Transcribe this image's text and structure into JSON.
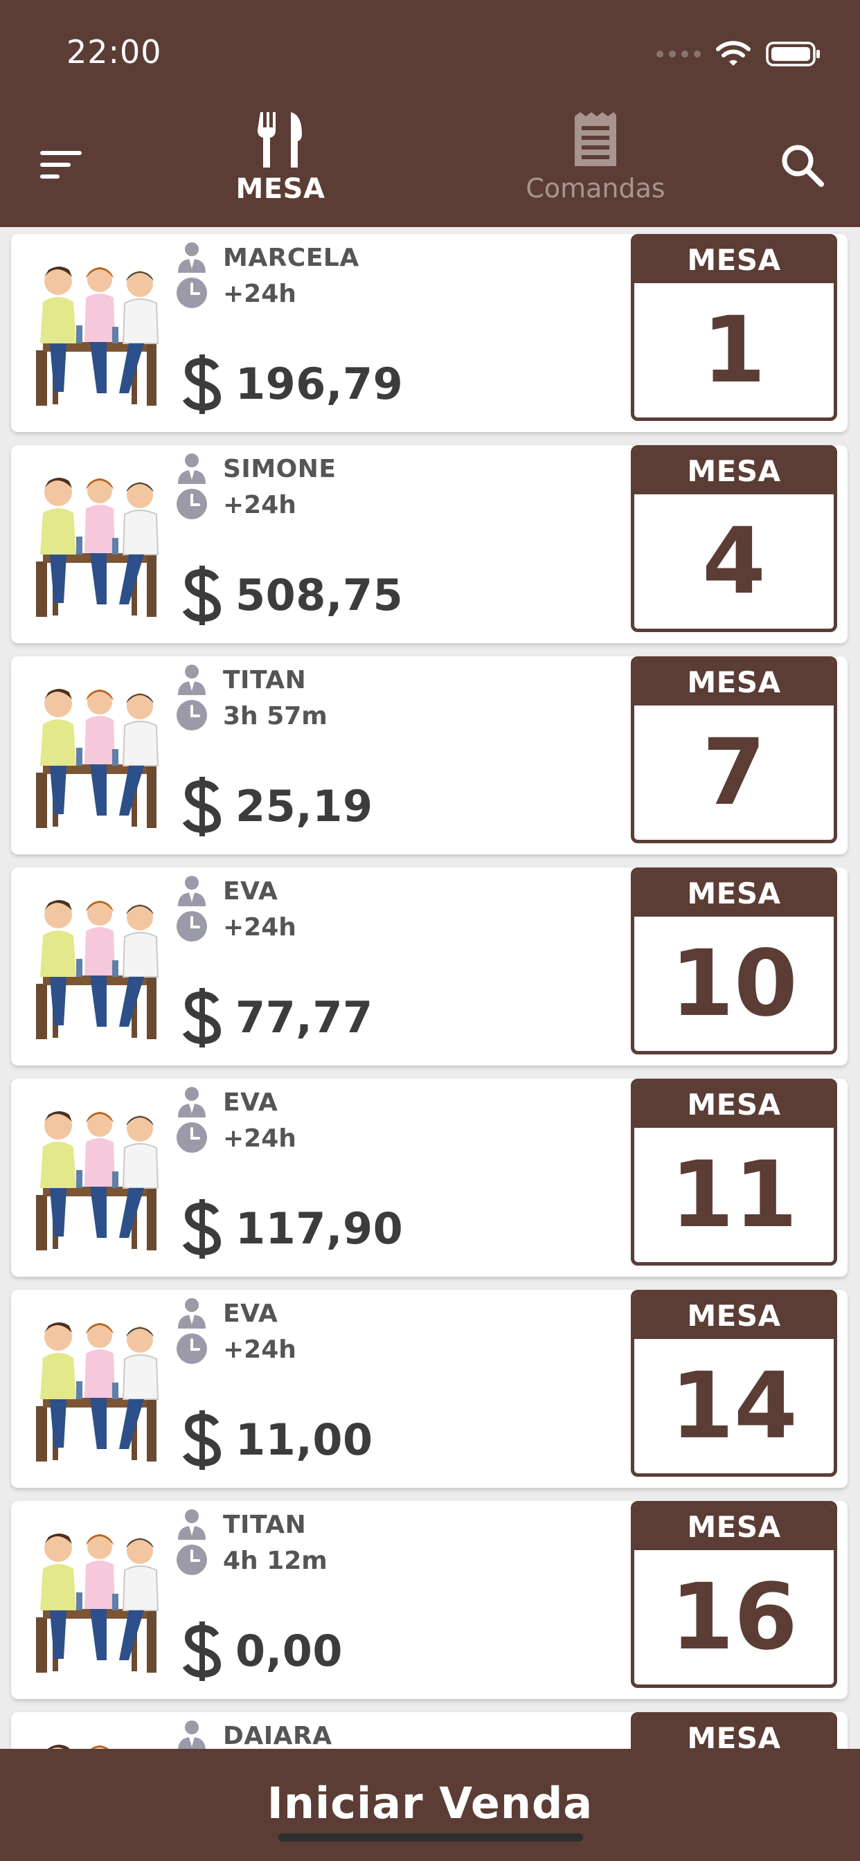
{
  "status_bar": {
    "time": "22:00"
  },
  "tabs": [
    {
      "label": "MESA",
      "icon": "fork-knife-icon",
      "active": true
    },
    {
      "label": "Comandas",
      "icon": "receipt-icon",
      "active": false
    }
  ],
  "tables": [
    {
      "waiter": "MARCELA",
      "elapsed": "+24h",
      "amount": "196,79",
      "badge_label": "MESA",
      "number": "1"
    },
    {
      "waiter": "SIMONE",
      "elapsed": "+24h",
      "amount": "508,75",
      "badge_label": "MESA",
      "number": "4"
    },
    {
      "waiter": "TITAN",
      "elapsed": "3h 57m",
      "amount": "25,19",
      "badge_label": "MESA",
      "number": "7"
    },
    {
      "waiter": "EVA",
      "elapsed": "+24h",
      "amount": "77,77",
      "badge_label": "MESA",
      "number": "10"
    },
    {
      "waiter": "EVA",
      "elapsed": "+24h",
      "amount": "117,90",
      "badge_label": "MESA",
      "number": "11"
    },
    {
      "waiter": "EVA",
      "elapsed": "+24h",
      "amount": "11,00",
      "badge_label": "MESA",
      "number": "14"
    },
    {
      "waiter": "TITAN",
      "elapsed": "4h 12m",
      "amount": "0,00",
      "badge_label": "MESA",
      "number": "16"
    },
    {
      "waiter": "DAIARA",
      "elapsed": "",
      "amount": "",
      "badge_label": "MESA",
      "number": ""
    }
  ],
  "bottom_bar": {
    "label": "Iniciar Venda"
  },
  "colors": {
    "primary": "#5b3d35",
    "inactive_tab": "#a89590",
    "icon_gray": "#9a9aa8"
  }
}
